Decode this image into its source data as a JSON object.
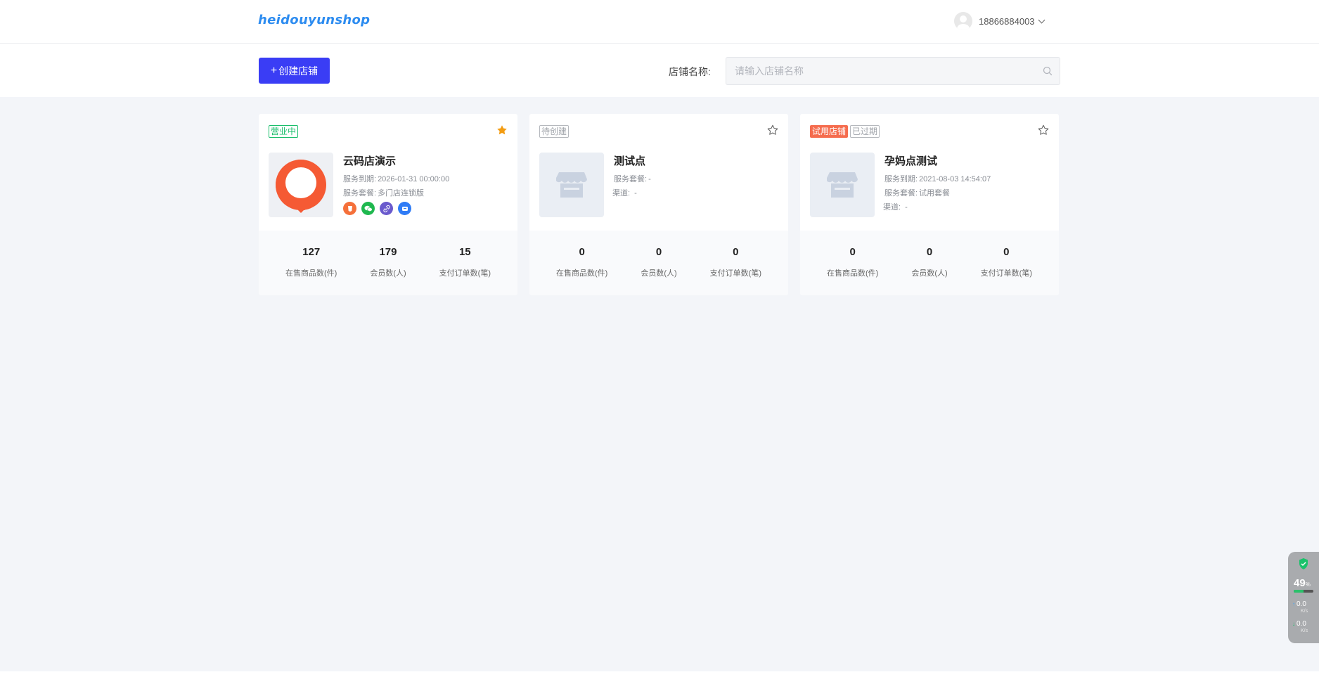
{
  "header": {
    "logo": "heidouyunshop",
    "user_phone": "18866884003"
  },
  "toolbar": {
    "create_label": "创建店铺",
    "search_label": "店铺名称:",
    "search_placeholder": "请输入店铺名称",
    "search_value": ""
  },
  "colors": {
    "primary": "#3a3df5",
    "open_green": "#19be6b",
    "trial_red": "#f56c4e",
    "star_orange": "#f39c12",
    "page_bg": "#f3f5f9"
  },
  "stat_labels": {
    "products": "在售商品数(件)",
    "members": "会员数(人)",
    "orders": "支付订单数(笔)"
  },
  "stores": [
    {
      "tags": [
        "营业中"
      ],
      "starred": true,
      "name": "云码店演示",
      "expire_label": "服务到期:",
      "expire_value": "2026-01-31 00:00:00",
      "plan_label": "服务套餐:",
      "plan_value": "多门店连锁版",
      "channel_icons": [
        "h5-icon",
        "wechat-icon",
        "link-icon",
        "miniapp-icon"
      ],
      "stats": {
        "products": "127",
        "members": "179",
        "orders": "15"
      }
    },
    {
      "tags": [
        "待创建"
      ],
      "starred": false,
      "name": "测试点",
      "plan_label": "服务套餐:",
      "plan_value": "-",
      "channel_label": "渠道:",
      "channel_value": "-",
      "stats": {
        "products": "0",
        "members": "0",
        "orders": "0"
      }
    },
    {
      "tags": [
        "试用店铺",
        "已过期"
      ],
      "starred": false,
      "name": "孕妈点测试",
      "expire_label": "服务到期:",
      "expire_value": "2021-08-03 14:54:07",
      "plan_label": "服务套餐:",
      "plan_value": "试用套餐",
      "channel_label": "渠道:",
      "channel_value": "-",
      "stats": {
        "products": "0",
        "members": "0",
        "orders": "0"
      }
    }
  ],
  "monitor": {
    "percent": "49",
    "percent_unit": "%",
    "cpu_fraction": 0.49,
    "upload": "0.0",
    "download": "0.0",
    "rate_unit": "K/s"
  }
}
